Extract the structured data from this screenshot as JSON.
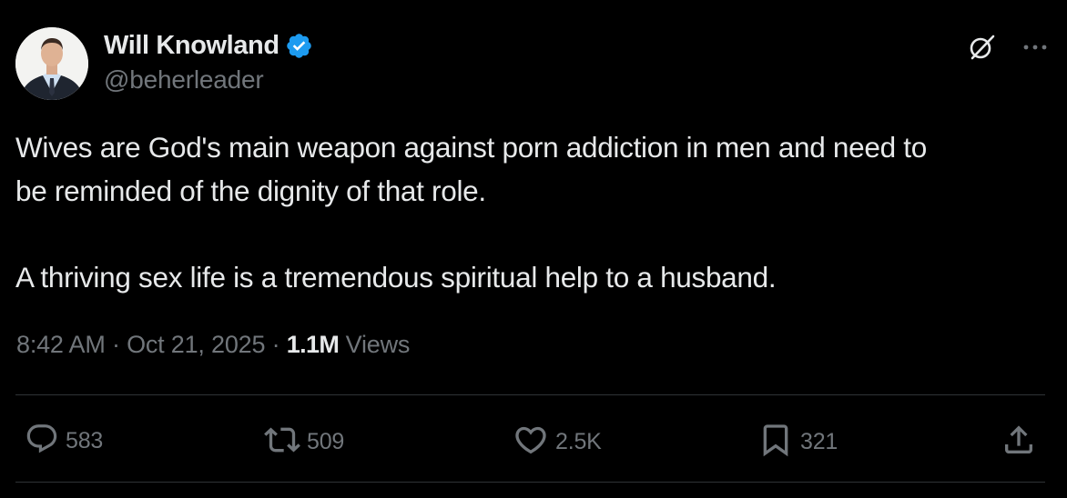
{
  "author": {
    "name": "Will Knowland",
    "handle": "@beherleader",
    "verified": true,
    "verified_color": "#1d9bf0"
  },
  "icons": {
    "avatar": "profile-photo",
    "verified": "verified-badge-icon",
    "grok": "grok-icon",
    "more": "more-icon",
    "reply": "reply-icon",
    "retweet": "retweet-icon",
    "like": "like-icon",
    "bookmark": "bookmark-icon",
    "share": "share-icon"
  },
  "tweet": {
    "line1": "Wives are God's main weapon against porn addiction in men and need to",
    "line2": "be reminded of the dignity of that role.",
    "line3": "A thriving sex life is a tremendous spiritual help to a husband."
  },
  "meta": {
    "time": "8:42 AM",
    "separator": " · ",
    "date": "Oct 21, 2025",
    "views_count": "1.1M",
    "views_label": " Views"
  },
  "stats": {
    "replies": "583",
    "reposts": "509",
    "likes": "2.5K",
    "bookmarks": "321"
  },
  "colors": {
    "background": "#000000",
    "text": "#e7e9ea",
    "secondary": "#71767b",
    "divider": "#2f3336"
  }
}
